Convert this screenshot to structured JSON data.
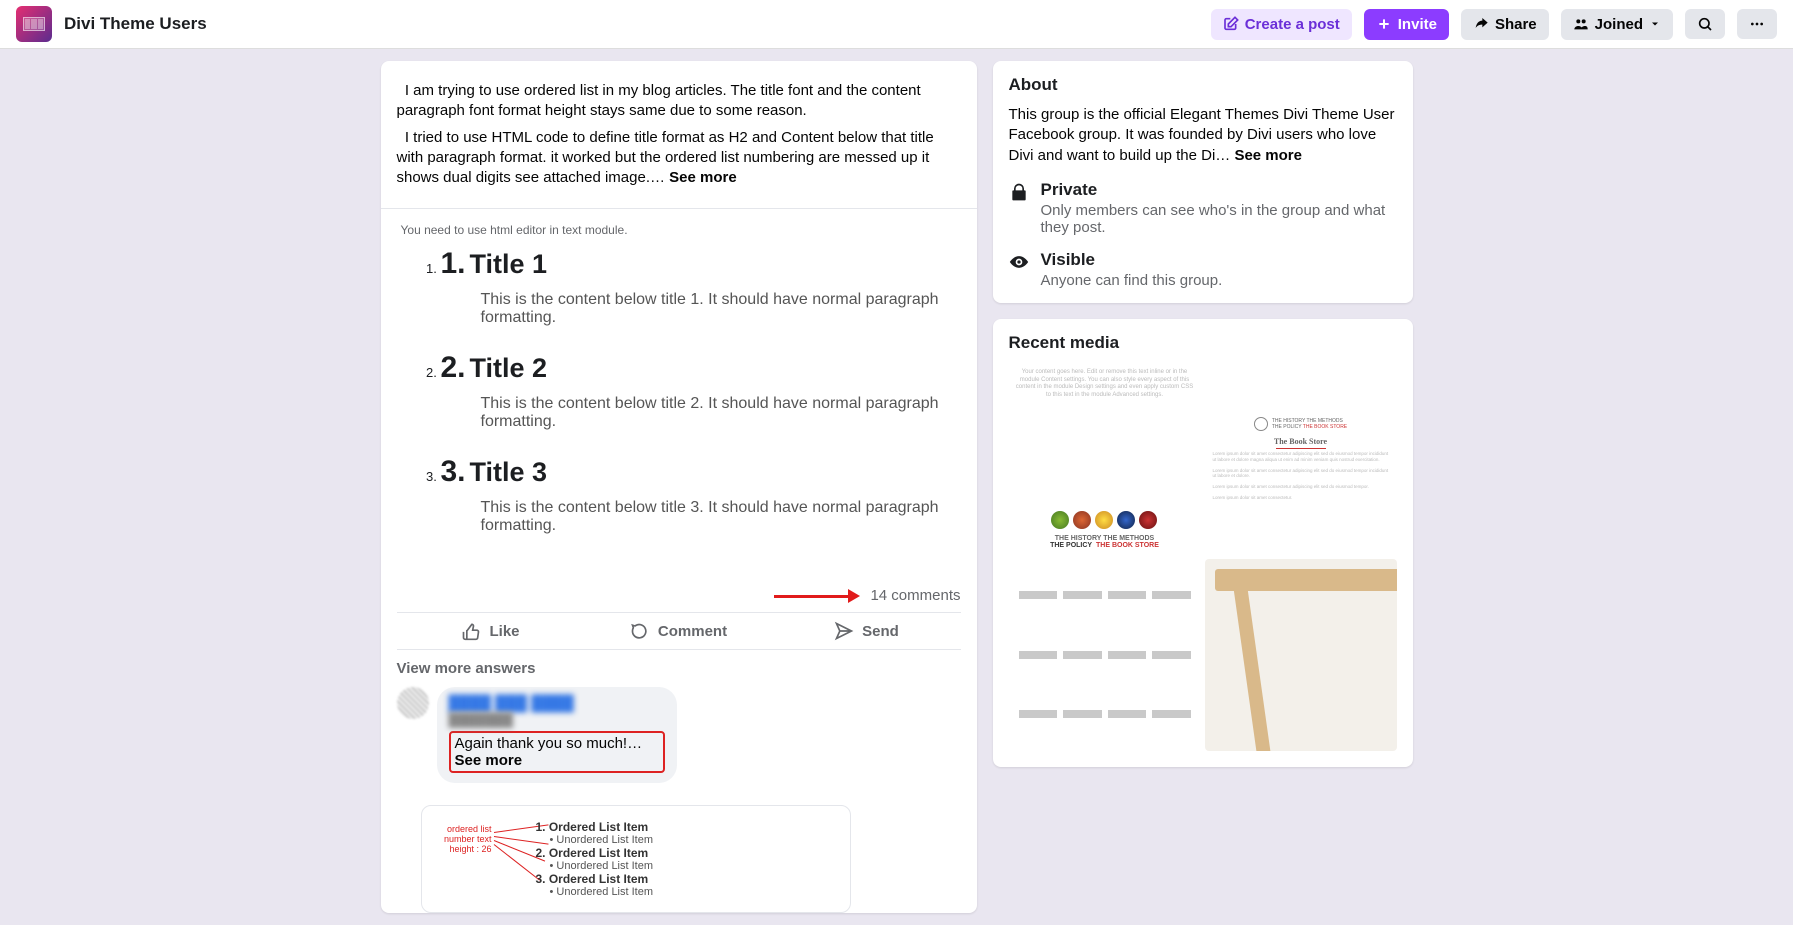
{
  "header": {
    "group_name": "Divi Theme Users",
    "create_post": "Create a post",
    "invite": "Invite",
    "share": "Share",
    "joined": "Joined"
  },
  "post": {
    "para1": "I am trying to use ordered list in my blog articles. The title font and the content paragraph font format height stays same due to some reason.",
    "para2_prefix": "I tried to use HTML code to define title format as H2 and Content below that title with paragraph format. it worked but the ordered list numbering are messed up it shows dual digits see attached image.… ",
    "see_more": "See more",
    "attached_hint": "You need to use html editor in text module.",
    "items": [
      {
        "num": "1.",
        "title": "Title 1",
        "desc": "This is the content below title 1. It should have normal paragraph formatting."
      },
      {
        "num": "2.",
        "title": "Title 2",
        "desc": "This is the content below title 2. It should have normal paragraph formatting."
      },
      {
        "num": "3.",
        "title": "Title 3",
        "desc": "This is the content below title 3. It should have normal paragraph formatting."
      }
    ],
    "comments_count": "14 comments",
    "actions": {
      "like": "Like",
      "comment": "Comment",
      "send": "Send"
    },
    "view_more": "View more answers"
  },
  "comment": {
    "name_blur": "████ ███ ████",
    "sub_blur": "███████",
    "text_prefix": "Again thank you so much!… ",
    "see_more": "See more",
    "nested": {
      "left_label": "ordered list number text height : 26",
      "ol1": "1. Ordered List Item",
      "ul1": "• Unordered List Item",
      "ol2": "2. Ordered List Item",
      "ul2": "• Unordered List Item",
      "ol3": "3. Ordered List Item",
      "ul3": "• Unordered List Item"
    }
  },
  "about": {
    "heading": "About",
    "text_prefix": "This group is the official Elegant Themes Divi Theme User Facebook group. It was founded by Divi users who love Divi and want to build up the Di… ",
    "see_more": "See more",
    "private_title": "Private",
    "private_sub": "Only members can see who's in the group and what they post.",
    "visible_title": "Visible",
    "visible_sub": "Anyone can find this group."
  },
  "media": {
    "heading": "Recent media",
    "thumb1_footer": "THE HISTORY  THE METHODS",
    "thumb1_footer2": "THE POLICY  THE BOOK STORE",
    "thumb2_title": "The Book Store"
  }
}
